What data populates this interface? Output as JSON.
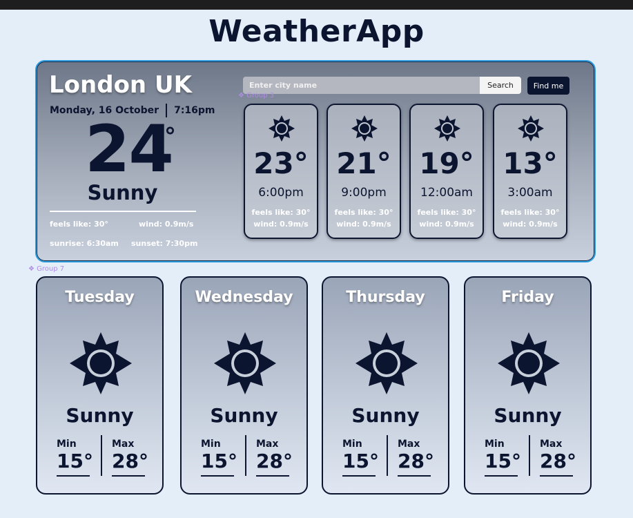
{
  "app": {
    "title": "WeatherApp"
  },
  "current": {
    "city": "London UK",
    "date": "Monday, 16 October",
    "time": "7:16pm",
    "temp": "24",
    "degree": "°",
    "condition": "Sunny",
    "feels_like": "feels like: 30°",
    "wind": "wind:  0.9m/s",
    "sunrise": "sunrise: 6:30am",
    "sunset": "sunset: 7:30pm"
  },
  "search": {
    "placeholder": "Enter city name",
    "search_label": "Search",
    "find_me_label": "Find me"
  },
  "design_labels": {
    "group3": "❖ Group 3",
    "group7": "❖ Group 7"
  },
  "hourly": [
    {
      "temp": "23°",
      "time": "6:00pm",
      "feels_like": "feels like: 30°",
      "wind": "wind:  0.9m/s",
      "icon": "sun-icon"
    },
    {
      "temp": "21°",
      "time": "9:00pm",
      "feels_like": "feels like: 30°",
      "wind": "wind:  0.9m/s",
      "icon": "sun-icon"
    },
    {
      "temp": "19°",
      "time": "12:00am",
      "feels_like": "feels like: 30°",
      "wind": "wind:  0.9m/s",
      "icon": "sun-icon"
    },
    {
      "temp": "13°",
      "time": "3:00am",
      "feels_like": "feels like: 30°",
      "wind": "wind:  0.9m/s",
      "icon": "sun-icon"
    }
  ],
  "daily": [
    {
      "day": "Tuesday",
      "condition": "Sunny",
      "min_label": "Min",
      "max_label": "Max",
      "min": "15°",
      "max": "28°",
      "icon": "sun-icon"
    },
    {
      "day": "Wednesday",
      "condition": "Sunny",
      "min_label": "Min",
      "max_label": "Max",
      "min": "15°",
      "max": "28°",
      "icon": "sun-icon"
    },
    {
      "day": "Thursday",
      "condition": "Sunny",
      "min_label": "Min",
      "max_label": "Max",
      "min": "15°",
      "max": "28°",
      "icon": "sun-icon"
    },
    {
      "day": "Friday",
      "condition": "Sunny",
      "min_label": "Min",
      "max_label": "Max",
      "min": "15°",
      "max": "28°",
      "icon": "sun-icon"
    }
  ],
  "colors": {
    "background": "#e3eef9",
    "navy": "#0c1530",
    "panel_border": "#2e9bdf",
    "design_label": "#b08ce6"
  }
}
